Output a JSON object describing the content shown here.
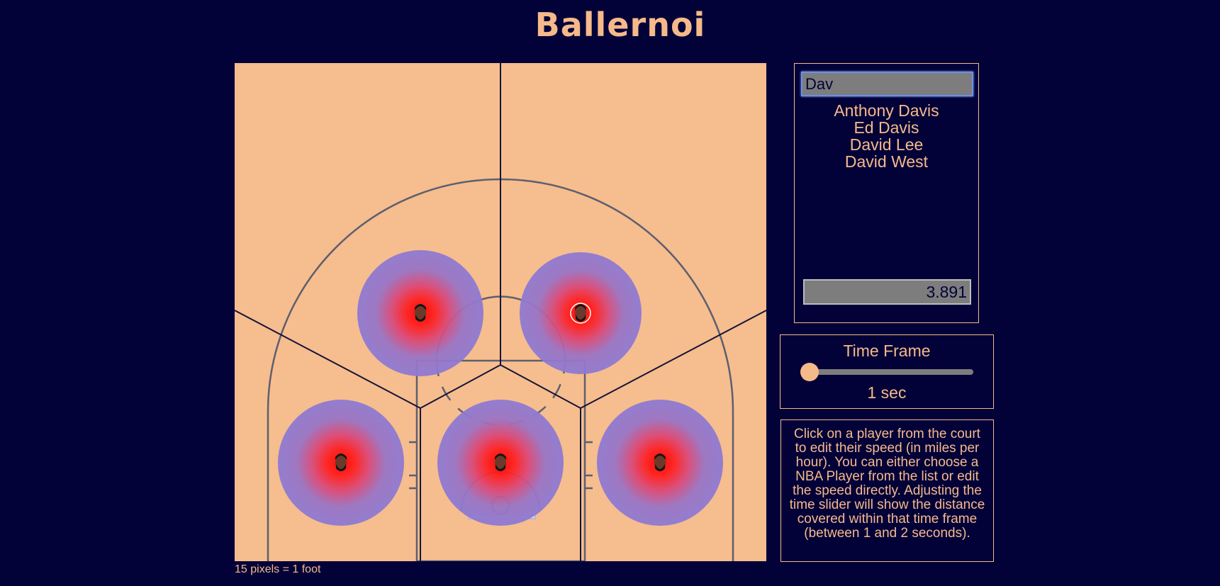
{
  "app": {
    "title": "Ballernoi",
    "scale_note": "15 pixels = 1 foot"
  },
  "player_panel": {
    "search_value": "Dav",
    "players": [
      "Anthony Davis",
      "Ed Davis",
      "David Lee",
      "David West"
    ],
    "speed_value": "3.891"
  },
  "time_panel": {
    "title": "Time Frame",
    "slider_value_fraction": 0,
    "value_label": "1 sec"
  },
  "help": {
    "text": "Click on a player from the court to edit their speed (in miles per hour). You can either choose a NBA Player from the list or edit the speed directly. Adjusting the time slider will show the distance covered within that time frame (between 1 and 2 seconds)."
  },
  "colors": {
    "background": "#020239",
    "court": "#f6bd8e",
    "accent": "#f6b98a",
    "zone_outer": "#8f78cc",
    "zone_core": "#ff1a1a"
  },
  "icons": {
    "player_marker": "player-face-icon"
  }
}
